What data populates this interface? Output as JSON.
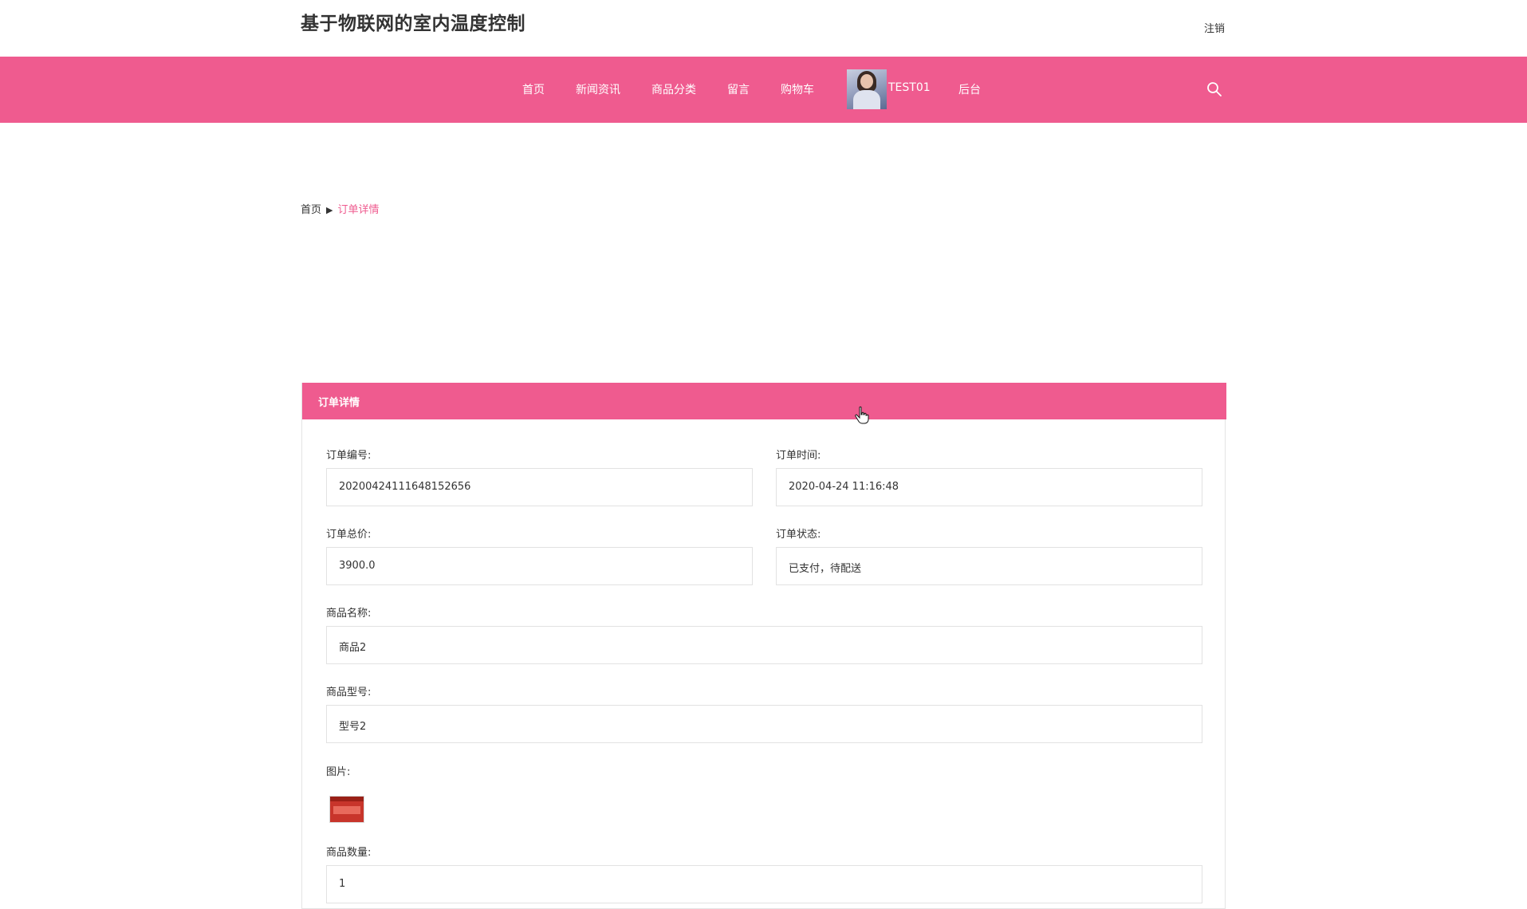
{
  "header": {
    "site_title": "基于物联网的室内温度控制",
    "logout_label": "注销"
  },
  "nav": {
    "items": [
      {
        "label": "首页"
      },
      {
        "label": "新闻资讯"
      },
      {
        "label": "商品分类"
      },
      {
        "label": "留言"
      },
      {
        "label": "购物车"
      }
    ],
    "username": "TEST01",
    "admin_label": "后台",
    "search_icon": "search-icon"
  },
  "breadcrumb": {
    "home": "首页",
    "separator": "▶",
    "current": "订单详情"
  },
  "panel": {
    "title": "订单详情",
    "fields": {
      "order_no": {
        "label": "订单编号:",
        "value": "20200424111648152656"
      },
      "order_time": {
        "label": "订单时间:",
        "value": "2020-04-24 11:16:48"
      },
      "total_price": {
        "label": "订单总价:",
        "value": "3900.0"
      },
      "order_status": {
        "label": "订单状态:",
        "value": "已支付，待配送"
      },
      "product_name": {
        "label": "商品名称:",
        "value": "商品2"
      },
      "product_model": {
        "label": "商品型号:",
        "value": "型号2"
      },
      "image": {
        "label": "图片:"
      },
      "quantity": {
        "label": "商品数量:",
        "value": "1"
      }
    }
  },
  "colors": {
    "accent": "#ef5b8f",
    "text": "#333333",
    "border": "#e2e2e2"
  }
}
